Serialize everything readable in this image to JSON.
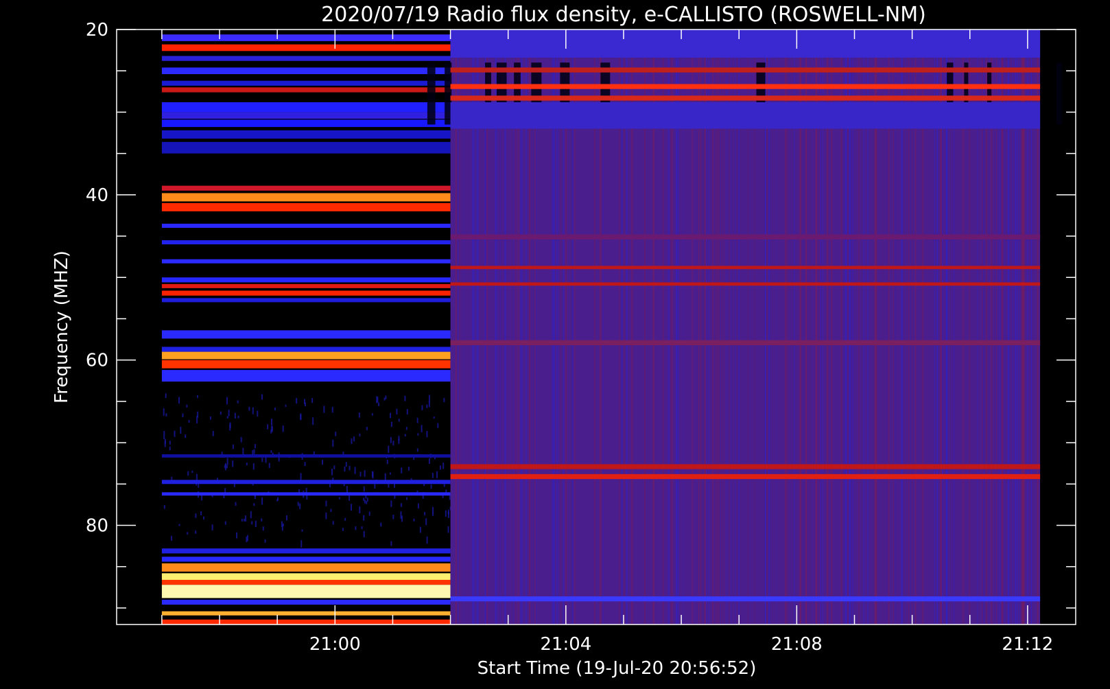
{
  "chart_data": {
    "type": "heatmap",
    "title": "2020/07/19  Radio flux density, e-CALLISTO (ROSWELL-NM)",
    "xlabel": "Start Time (19-Jul-20 20:56:52)",
    "ylabel": "Frequency (MHZ)",
    "x_axis": {
      "unit": "time",
      "range": [
        "20:56:13",
        "21:12:50"
      ],
      "major_ticks": [
        "21:00",
        "21:04",
        "21:08",
        "21:12"
      ],
      "minor_tick_interval_minutes": 1
    },
    "y_axis": {
      "unit": "MHz",
      "range": [
        20,
        92
      ],
      "inverted": true,
      "major_ticks": [
        20,
        40,
        60,
        80
      ],
      "minor_tick_interval": 5
    },
    "data_extent": {
      "start_time": "20:57:00",
      "end_time": "21:12:13",
      "freq_min": 20,
      "freq_max": 92
    },
    "segments": [
      {
        "name": "",
        "start_time": "20:57:00",
        "end_time": "21:02:00",
        "background": "#000000",
        "bands": [
          {
            "f": [
              20.6,
              21.4
            ],
            "color": "#3b2bff"
          },
          {
            "f": [
              21.8,
              22.6
            ],
            "color": "#ff2200"
          },
          {
            "f": [
              23.2,
              23.8
            ],
            "color": "#2a20d8"
          },
          {
            "f": [
              24.6,
              25.4
            ],
            "color": "#2b2bff"
          },
          {
            "f": [
              26.2,
              26.8
            ],
            "color": "#1a1ad0"
          },
          {
            "f": [
              27.0,
              27.6
            ],
            "color": "#c81818"
          },
          {
            "f": [
              28.8,
              30.0
            ],
            "color": "#1f1fff"
          },
          {
            "f": [
              30.0,
              30.8
            ],
            "color": "#3020e0"
          },
          {
            "f": [
              30.9,
              31.8
            ],
            "color": "#1818ff"
          },
          {
            "f": [
              32.2,
              33.2
            ],
            "color": "#1616c8"
          },
          {
            "f": [
              33.6,
              35.0
            ],
            "color": "#1414b8"
          },
          {
            "f": [
              38.9,
              39.5
            ],
            "color": "#d0182a"
          },
          {
            "f": [
              39.8,
              40.8
            ],
            "color": "#ff8c1a"
          },
          {
            "f": [
              41.0,
              42.0
            ],
            "color": "#ff2a00"
          },
          {
            "f": [
              43.5,
              44.0
            ],
            "color": "#2828ff"
          },
          {
            "f": [
              45.5,
              46.0
            ],
            "color": "#2222ee"
          },
          {
            "f": [
              47.8,
              48.3
            ],
            "color": "#2a2aff"
          },
          {
            "f": [
              50.0,
              50.6
            ],
            "color": "#2626ff"
          },
          {
            "f": [
              50.8,
              51.3
            ],
            "color": "#e01a10"
          },
          {
            "f": [
              51.6,
              52.2
            ],
            "color": "#ff2200"
          },
          {
            "f": [
              52.5,
              53.0
            ],
            "color": "#1e1ed8"
          },
          {
            "f": [
              56.4,
              57.4
            ],
            "color": "#2a2aff"
          },
          {
            "f": [
              58.4,
              59.0
            ],
            "color": "#2020e0"
          },
          {
            "f": [
              59.0,
              59.9
            ],
            "color": "#ffa020"
          },
          {
            "f": [
              60.0,
              61.0
            ],
            "color": "#ff3300"
          },
          {
            "f": [
              61.2,
              62.6
            ],
            "color": "#2a2aff"
          },
          {
            "f": [
              71.4,
              71.8
            ],
            "color": "#1010a0"
          },
          {
            "f": [
              74.5,
              75.0
            ],
            "color": "#2020e0"
          },
          {
            "f": [
              76.0,
              76.4
            ],
            "color": "#2a2aff"
          },
          {
            "f": [
              82.8,
              83.4
            ],
            "color": "#2020e0"
          },
          {
            "f": [
              83.8,
              84.4
            ],
            "color": "#2828ff"
          },
          {
            "f": [
              84.6,
              85.6
            ],
            "color": "#ff8c1a"
          },
          {
            "f": [
              85.8,
              86.6
            ],
            "color": "#fff070"
          },
          {
            "f": [
              86.6,
              87.2
            ],
            "color": "#ff3300"
          },
          {
            "f": [
              87.2,
              88.8
            ],
            "color": "#fff8b0"
          },
          {
            "f": [
              89.0,
              89.6
            ],
            "color": "#2a2aff"
          },
          {
            "f": [
              90.4,
              90.9
            ],
            "color": "#ffb030"
          },
          {
            "f": [
              91.4,
              92.0
            ],
            "color": "#ff2a00"
          }
        ]
      },
      {
        "name": "",
        "start_time": "21:02:00",
        "end_time": "21:12:13",
        "background": "#4a1e8c",
        "bands": [
          {
            "f": [
              20.0,
              23.4
            ],
            "color": "#3a28d0"
          },
          {
            "f": [
              24.6,
              25.2
            ],
            "color": "#c0201c"
          },
          {
            "f": [
              26.6,
              27.2
            ],
            "color": "#ff3010"
          },
          {
            "f": [
              28.0,
              28.6
            ],
            "color": "#d8281a"
          },
          {
            "f": [
              28.8,
              32.0
            ],
            "color": "#3826c8"
          },
          {
            "f": [
              44.8,
              45.4
            ],
            "color": "#6a1a70"
          },
          {
            "f": [
              48.6,
              49.0
            ],
            "color": "#c01818"
          },
          {
            "f": [
              50.6,
              51.0
            ],
            "color": "#c01818"
          },
          {
            "f": [
              57.6,
              58.2
            ],
            "color": "#7a2060"
          },
          {
            "f": [
              72.6,
              73.2
            ],
            "color": "#c01818"
          },
          {
            "f": [
              73.8,
              74.4
            ],
            "color": "#e02010"
          },
          {
            "f": [
              88.6,
              89.2
            ],
            "color": "#3a3aff"
          }
        ]
      }
    ],
    "colorscale": [
      "#000000",
      "#1e1eff",
      "#4a1e8c",
      "#ff2a00",
      "#ff8c1a",
      "#fff8b0"
    ],
    "grid": false,
    "legend": "none"
  }
}
